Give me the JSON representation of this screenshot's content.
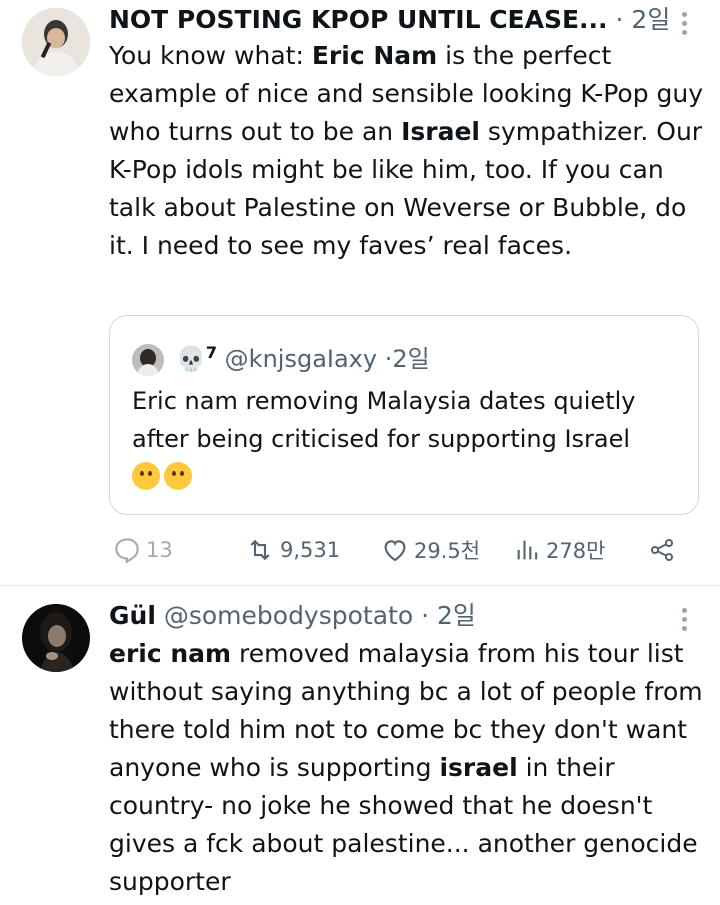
{
  "post1": {
    "display_name": "NOT POSTING KPOP UNTIL CEASE...",
    "dot": "·",
    "time": "2일",
    "text_segments": [
      {
        "t": "You know what: ",
        "b": false
      },
      {
        "t": "Eric Nam",
        "b": true
      },
      {
        "t": " is the perfect example of nice and sensible looking K-Pop guy who turns out to be an ",
        "b": false
      },
      {
        "t": "Israel",
        "b": true
      },
      {
        "t": " sympathizer. Our K-Pop idols might be like him, too. If you can talk about Palestine on Weverse or Bubble, do it. I need to see my faves’ real faces.",
        "b": false
      }
    ],
    "quote": {
      "name_emoji": "💀",
      "name_sup": "7",
      "handle": "@knjsgaIaxy",
      "dot": "·",
      "time": "2일",
      "text": "Eric nam removing Malaysia dates quietly after being criticised for supporting Israel",
      "emojis": [
        "slightly-smiling-face",
        "slightly-smiling-face"
      ]
    },
    "actions": {
      "replies": "13",
      "reposts": "9,531",
      "likes": "29.5천",
      "views": "278만"
    },
    "icons": [
      "reply-icon",
      "repost-icon",
      "like-icon",
      "views-icon",
      "share-icon",
      "more-icon"
    ]
  },
  "post2": {
    "display_name": "Gül",
    "handle": "@somebodyspotato",
    "dot": "·",
    "time": "2일",
    "text_segments": [
      {
        "t": "eric nam",
        "b": true
      },
      {
        "t": " removed malaysia from his tour list without saying anything bc a lot of people from there told him not to come bc they don't want anyone who is supporting ",
        "b": false
      },
      {
        "t": "israel",
        "b": true
      },
      {
        "t": " in their country- no joke he showed that he doesn't gives a fck about palestine... another genocide supporter",
        "b": false
      }
    ]
  },
  "colors": {
    "text": "#0f1419",
    "muted": "#536471",
    "border": "#cfd9de",
    "divider": "#e6ecf0"
  }
}
